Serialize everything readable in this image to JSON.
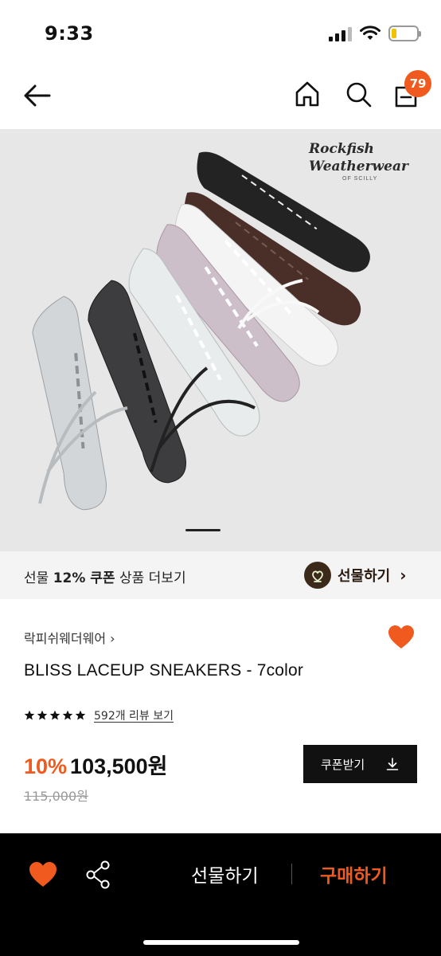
{
  "status_bar": {
    "time": "9:33",
    "icons": [
      "signal-icon",
      "wifi-icon",
      "battery-icon"
    ]
  },
  "top_nav": {
    "icons": [
      "back-arrow-icon",
      "home-icon",
      "search-icon",
      "shopping-bag-icon"
    ],
    "cart_count": "79",
    "badge_color": "#f05a1e"
  },
  "hero": {
    "brand_logo_line1": "Rockfish",
    "brand_logo_line2": "Weatherwear",
    "brand_logo_sub": "OF SCILLY",
    "slide_indicator": "1"
  },
  "coupon_banner": {
    "prefix": "선물 ",
    "highlight": "12% 쿠폰",
    "suffix": " 상품 더보기",
    "gift_label": "선물하기",
    "gift_chevron": "›"
  },
  "product": {
    "brand": "락피쉬웨더웨어 ›",
    "title": "BLISS LACEUP SNEAKERS - 7color",
    "rating_stars": 5,
    "review_link": "592개 리뷰 보기",
    "discount": "10%",
    "price": "103,500원",
    "original_price": "115,000원",
    "coupon_button": "쿠폰받기"
  },
  "bottom_bar": {
    "gift_label": "선물하기",
    "buy_label": "구매하기",
    "accent_color": "#f05a1e"
  }
}
